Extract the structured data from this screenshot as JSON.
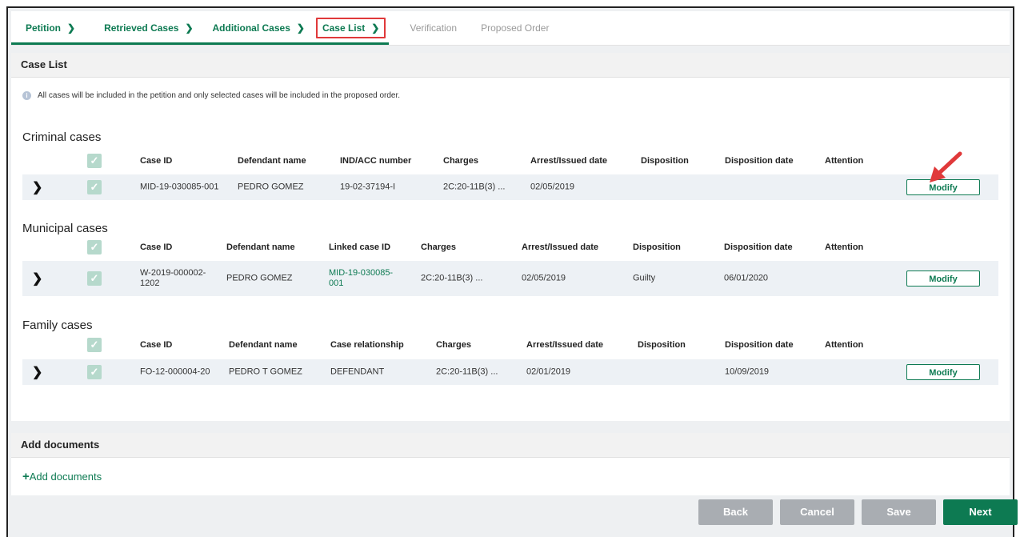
{
  "wizard": {
    "steps": [
      {
        "label": "Petition"
      },
      {
        "label": "Retrieved Cases"
      },
      {
        "label": "Additional Cases"
      },
      {
        "label": "Case List"
      },
      {
        "label": "Verification"
      },
      {
        "label": "Proposed Order"
      }
    ]
  },
  "case_list": {
    "title": "Case List",
    "info_text": "All cases will be included in the petition and only selected cases will be included in the proposed order.",
    "criminal": {
      "title": "Criminal cases",
      "headers": [
        "Case ID",
        "Defendant name",
        "IND/ACC number",
        "Charges",
        "Arrest/Issued date",
        "Disposition",
        "Disposition date",
        "Attention"
      ],
      "row": {
        "case_id": "MID-19-030085-001",
        "defendant": "PEDRO GOMEZ",
        "ind_acc": "19-02-37194-I",
        "charges": "2C:20-11B(3) ...",
        "arrest_date": "02/05/2019",
        "disposition": "",
        "disposition_date": "",
        "attention": "",
        "modify": "Modify"
      }
    },
    "municipal": {
      "title": "Municipal cases",
      "headers": [
        "Case ID",
        "Defendant name",
        "Linked case ID",
        "Charges",
        "Arrest/Issued date",
        "Disposition",
        "Disposition date",
        "Attention"
      ],
      "row": {
        "case_id_1": "W-2019-000002-",
        "case_id_2": "1202",
        "defendant": "PEDRO GOMEZ",
        "linked_1": "MID-19-030085-",
        "linked_2": "001",
        "charges": "2C:20-11B(3) ...",
        "arrest_date": "02/05/2019",
        "disposition": "Guilty",
        "disposition_date": "06/01/2020",
        "attention": "",
        "modify": "Modify"
      }
    },
    "family": {
      "title": "Family cases",
      "headers": [
        "Case ID",
        "Defendant name",
        "Case relationship",
        "Charges",
        "Arrest/Issued date",
        "Disposition",
        "Disposition date",
        "Attention"
      ],
      "row": {
        "case_id": "FO-12-000004-20",
        "defendant": "PEDRO T GOMEZ",
        "relationship": "DEFENDANT",
        "charges": "2C:20-11B(3) ...",
        "arrest_date": "02/01/2019",
        "disposition": "",
        "disposition_date": "10/09/2019",
        "attention": "",
        "modify": "Modify"
      }
    }
  },
  "documents": {
    "title": "Add documents",
    "add_plus": "+",
    "add_label": "Add documents"
  },
  "footer": {
    "back": "Back",
    "cancel": "Cancel",
    "save": "Save",
    "next": "Next"
  },
  "icons": {
    "chevron": "chevron-right-icon",
    "check": "checkbox-checked-icon",
    "info": "info-icon",
    "arrow": "red-arrow-annotation"
  },
  "colors": {
    "accent": "#0d7a52",
    "highlight": "#e0393a",
    "row_bg": "#edf1f5",
    "button_grey": "#a9adb2"
  }
}
